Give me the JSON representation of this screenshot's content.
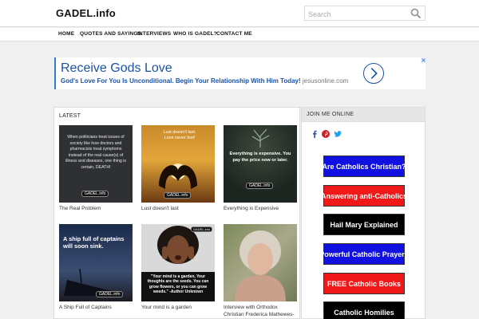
{
  "header": {
    "logo": "GADEL.info",
    "search_placeholder": "Search",
    "search_icon": "search-icon"
  },
  "nav": {
    "items": [
      "HOME",
      "QUOTES AND SAYINGS",
      "INTERVIEWS",
      "WHO IS GADEL?",
      "CONTACT ME"
    ]
  },
  "ad": {
    "title": "Receive Gods Love",
    "text": "God's Love For You Is Unconditional. Begin Your Relationship With Him Today!",
    "url": "jesusonline.com",
    "accent": "#1a52a8"
  },
  "latest": {
    "title": "LATEST",
    "posts": [
      {
        "caption": "The Real Problem",
        "thumb_text": "When politicians treat issues of society like how doctors and pharmacists treat symptoms instead of the real cause(s) of illness and diseases, one thing is certain, DEATH!",
        "watermark": "GADEL.info"
      },
      {
        "caption": "Lust doesn't last",
        "thumb_text": "Lust doesn't last. Love never lost!",
        "watermark": "GADEL.info"
      },
      {
        "caption": "Everything is Expensive",
        "thumb_text": "Everything is expensive. You pay the price now or later.",
        "watermark": "GADEL.info"
      },
      {
        "caption": "A Ship Full of Captains",
        "thumb_text": "A ship full of captains will soon sink.",
        "watermark": "GADEL.info"
      },
      {
        "caption": "Your mind is a garden",
        "thumb_text": "\"Your mind is a garden, Your thoughts are the seeds. You can grow flowers, or you can grow weeds.\" -Author Unknown",
        "watermark": "GADEL.info"
      },
      {
        "caption": "Interview with Orthodox Christian Frederica Mathewes-",
        "thumb_text": "",
        "watermark": ""
      }
    ]
  },
  "sidebar": {
    "title": "JOIN ME ONLINE",
    "social_icons": [
      "facebook-icon",
      "pinterest-icon",
      "twitter-icon"
    ],
    "promos": [
      {
        "label": "Are Catholics Christian?",
        "color": "#1010e0"
      },
      {
        "label": "Answering anti-Catholics",
        "color": "#f01818"
      },
      {
        "label": "Hail Mary Explained",
        "color": "#000000"
      },
      {
        "label": "Powerful Catholic Prayers",
        "color": "#1010e0"
      },
      {
        "label": "FREE Catholic Books",
        "color": "#f01818"
      },
      {
        "label": "Catholic Homilies",
        "color": "#000000"
      }
    ]
  }
}
